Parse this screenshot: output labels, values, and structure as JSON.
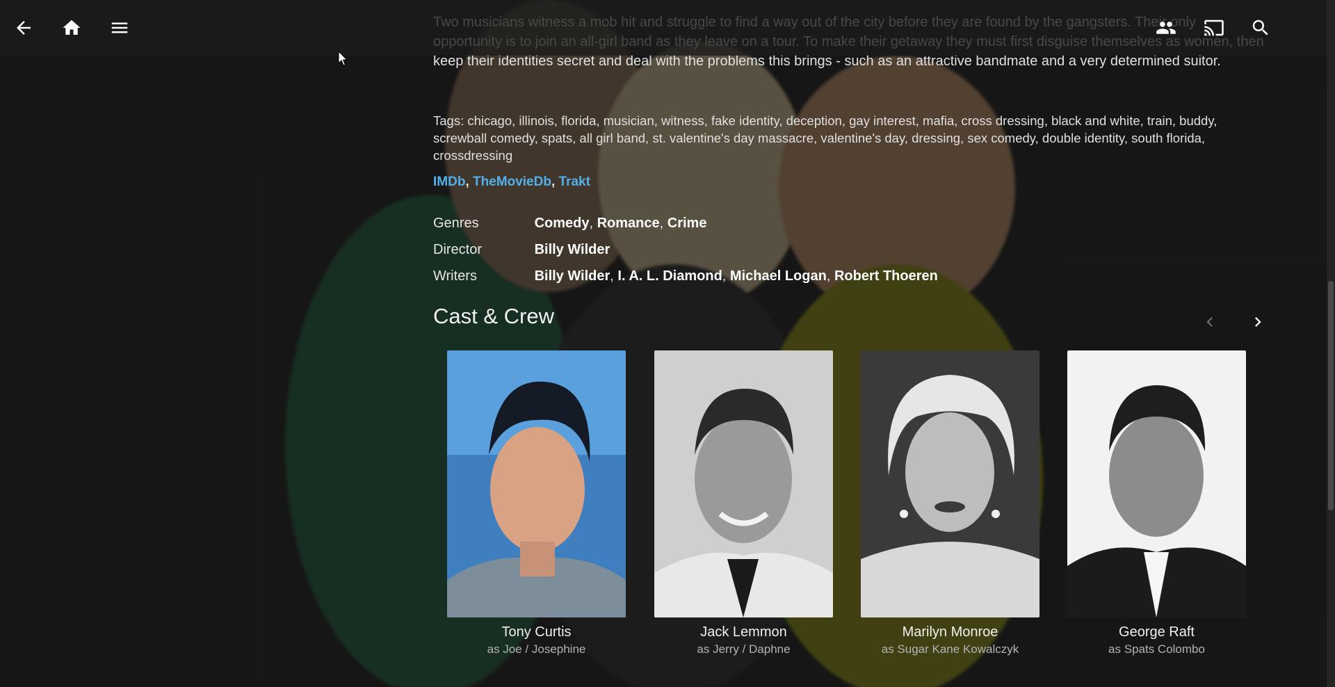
{
  "header": {
    "back_icon": "arrow-back-icon",
    "home_icon": "home-icon",
    "menu_icon": "hamburger-menu-icon",
    "sync_icon": "people-sync-icon",
    "cast_icon": "cast-icon",
    "search_icon": "search-icon"
  },
  "overview": "Two musicians witness a mob hit and struggle to find a way out of the city before they are found by the gangsters. Their only opportunity is to join an all-girl band as they leave on a tour. To make their getaway they must first disguise themselves as women, then keep their identities secret and deal with the problems this brings - such as an attractive bandmate and a very determined suitor.",
  "tags": {
    "label": "Tags:",
    "items": "chicago, illinois, florida, musician, witness, fake identity, deception, gay interest, mafia, cross dressing, black and white, train, buddy, screwball comedy, spats, all girl band, st. valentine's day massacre, valentine's day, dressing, sex comedy, double identity, south florida, crossdressing"
  },
  "links": [
    "IMDb",
    "TheMovieDb",
    "Trakt"
  ],
  "details": {
    "genres_label": "Genres",
    "genres": [
      "Comedy",
      "Romance",
      "Crime"
    ],
    "director_label": "Director",
    "director": "Billy Wilder",
    "writers_label": "Writers",
    "writers": [
      "Billy Wilder",
      "I. A. L. Diamond",
      "Michael Logan",
      "Robert Thoeren"
    ]
  },
  "cast_section": {
    "title": "Cast & Crew",
    "prev_icon": "chevron-left-icon",
    "next_icon": "chevron-right-icon",
    "members": [
      {
        "name": "Tony Curtis",
        "role": "as Joe / Josephine"
      },
      {
        "name": "Jack Lemmon",
        "role": "as Jerry / Daphne"
      },
      {
        "name": "Marilyn Monroe",
        "role": "as Sugar Kane Kowalczyk"
      },
      {
        "name": "George Raft",
        "role": "as Spats Colombo"
      }
    ]
  },
  "colors": {
    "background": "#1c1c1c",
    "link": "#52b0ea",
    "text": "#e6e6e6"
  }
}
